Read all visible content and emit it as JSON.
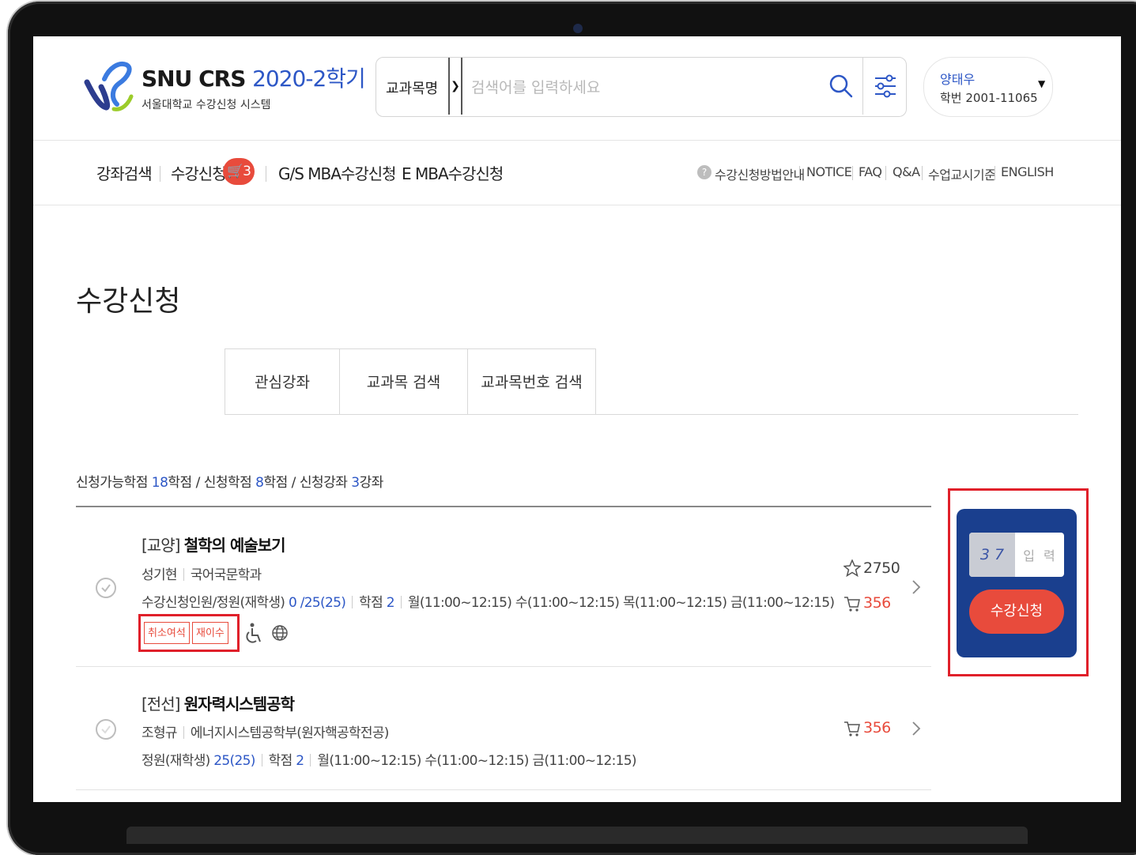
{
  "app": {
    "logo_text": "SNU CRS",
    "semester": "2020-2학기",
    "subtitle": "서울대학교 수강신청 시스템"
  },
  "search": {
    "category": "교과목명",
    "placeholder": "검색어를 입력하세요"
  },
  "user": {
    "name": "양태우",
    "student_id": "학번 2001-11065"
  },
  "nav": {
    "items": [
      "강좌검색",
      "수강신청",
      "G/S MBA수강신청",
      "E MBA수강신청"
    ],
    "cart_count": "3"
  },
  "util_links": [
    "수강신청방법안내",
    "NOTICE",
    "FAQ",
    "Q&A",
    "수업교시기준",
    "ENGLISH"
  ],
  "page": {
    "title": "수강신청",
    "tabs": [
      "관심강좌",
      "교과목 검색",
      "교과목번호 검색"
    ]
  },
  "summary": {
    "label1": "신청가능학점 ",
    "val1": "18",
    "unit1": "학점 / 신청학점 ",
    "val2": "8",
    "unit2": "학점 / 신청강좌 ",
    "val3": "3",
    "unit3": "강좌"
  },
  "courses": [
    {
      "type": "[교양]",
      "name": "철학의 예술보기",
      "professor": "성기현",
      "department": "국어국문학과",
      "enroll_label": "수강신청인원/정원(재학생)",
      "enroll_value": "0 /25(25)",
      "credit_label": "학점",
      "credit_value": "2",
      "schedule": "월(11:00~12:15) 수(11:00~12:15) 목(11:00~12:15) 금(11:00~12:15)",
      "tags": [
        "취소여석",
        "재이수"
      ],
      "stars": "2750",
      "cart": "356"
    },
    {
      "type": "[전선]",
      "name": "원자력시스템공학",
      "professor": "조형규",
      "department": "에너지시스템공학부(원자핵공학전공)",
      "enroll_label": "정원(재학생)",
      "enroll_value": "25(25)",
      "credit_label": "학점",
      "credit_value": "2",
      "schedule": "월(11:00~12:15) 수(11:00~12:15) 금(11:00~12:15)",
      "cart": "356"
    }
  ],
  "panel": {
    "captcha": "3 7",
    "input_placeholder": "입 력",
    "button": "수강신청"
  },
  "colors": {
    "brand_blue": "#2d57c6",
    "panel_navy": "#1a3f8e",
    "accent_red": "#e84b3c",
    "highlight_red": "#e0202a"
  }
}
